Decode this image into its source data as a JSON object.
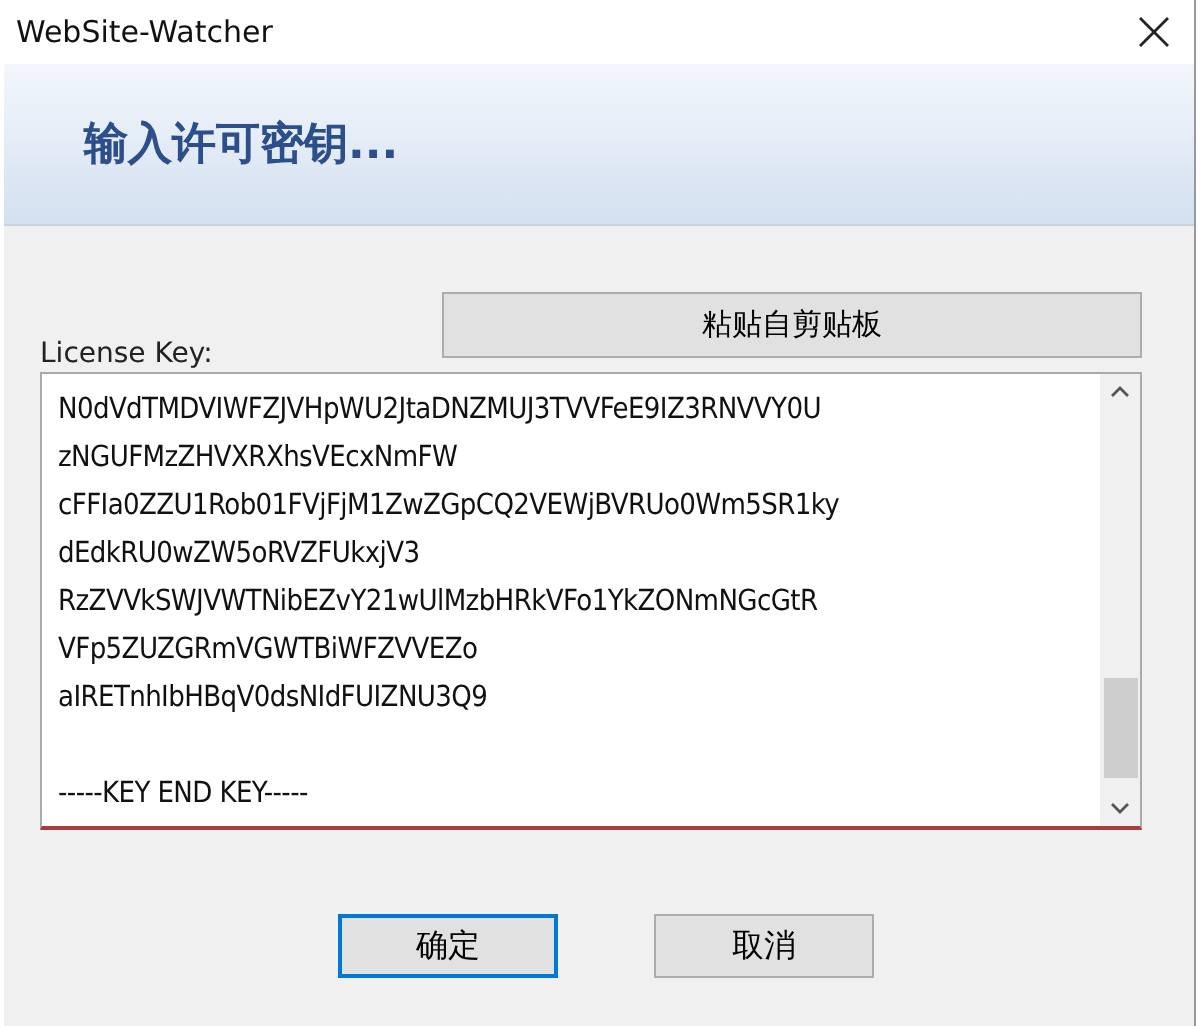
{
  "window": {
    "title": "WebSite-Watcher"
  },
  "header": {
    "title": "输入许可密钥..."
  },
  "license_key": {
    "label": "License Key:",
    "paste_button": "粘贴自剪贴板",
    "lines": [
      "N0dVdTMDVIWFZJVHpWU2JtaDNZMUJ3TVVFeE9IZ3RNVVY0U",
      "zNGUFMzZHVXRXhsVEcxNmFW",
      "cFFIa0ZZU1Rob01FVjFjM1ZwZGpCQ2VEWjBVRUo0Wm5SR1ky",
      "dEdkRU0wZW5oRVZFUkxjV3",
      "RzZVVkSWJVWTNibEZvY21wUlMzbHRkVFo1YkZONmNGcGtR",
      "VFp5ZUZGRmVGWTBiWFZVVEZo",
      "aIRETnhIbHBqV0dsNIdFUIZNU3Q9"
    ],
    "end_marker": "-----KEY END KEY-----"
  },
  "buttons": [
    {
      "label": "确定",
      "focused": true
    },
    {
      "label": "取消",
      "focused": false
    }
  ]
}
